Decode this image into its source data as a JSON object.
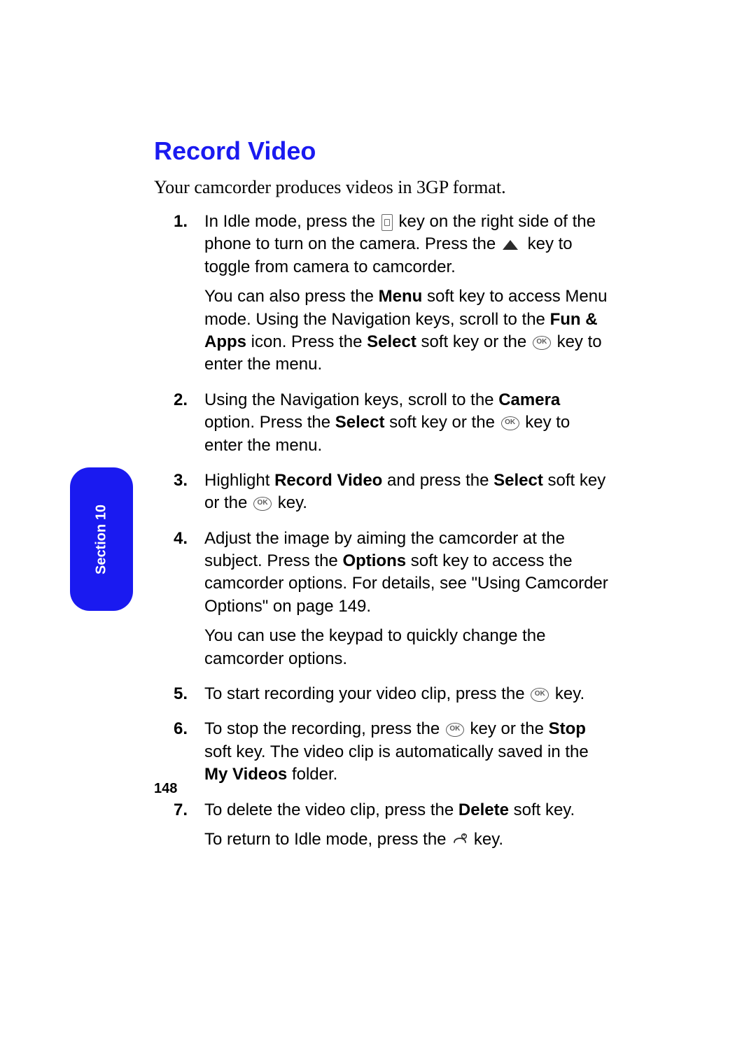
{
  "section_tab": "Section 10",
  "title": "Record Video",
  "intro": "Your camcorder produces videos in 3GP format.",
  "steps": {
    "s1": {
      "p1_a": "In Idle mode, press the ",
      "p1_b": " key on the right side of the phone to turn on the camera. Press the ",
      "p1_c": " key to toggle from camera to camcorder.",
      "p2_a": "You can also press the ",
      "menu": "Menu",
      "p2_b": " soft key to access Menu mode. Using the Navigation keys, scroll to the ",
      "funapps": "Fun & Apps",
      "p2_c": " icon. Press the ",
      "select": "Select",
      "p2_d": " soft key or the ",
      "p2_e": " key to enter the menu."
    },
    "s2": {
      "a": "Using the Navigation keys, scroll to the ",
      "camera": "Camera",
      "b": " option. Press the ",
      "select": "Select",
      "c": " soft key or the ",
      "d": " key to enter the menu."
    },
    "s3": {
      "a": "Highlight ",
      "rv": "Record Video",
      "b": " and press the ",
      "select": "Select",
      "c": " soft key or the ",
      "d": " key."
    },
    "s4": {
      "p1_a": "Adjust the image by aiming the camcorder at the subject. Press the ",
      "options": "Options",
      "p1_b": " soft key to access the camcorder options. For details, see \"Using Camcorder Options\" on page 149.",
      "p2": "You can use the keypad to quickly change the camcorder options."
    },
    "s5": {
      "a": "To start recording your video clip, press the ",
      "b": " key."
    },
    "s6": {
      "a": "To stop the recording, press the ",
      "b": " key or the ",
      "stop": "Stop",
      "c": " soft key. The video clip is automatically saved in the ",
      "myvideos": "My Videos",
      "d": " folder."
    },
    "s7": {
      "p1_a": "To delete the video clip, press the ",
      "delete": "Delete",
      "p1_b": " soft key.",
      "p2_a": "To return to Idle mode, press the ",
      "p2_b": " key."
    }
  },
  "ok_label": "OK",
  "page_number": "148"
}
